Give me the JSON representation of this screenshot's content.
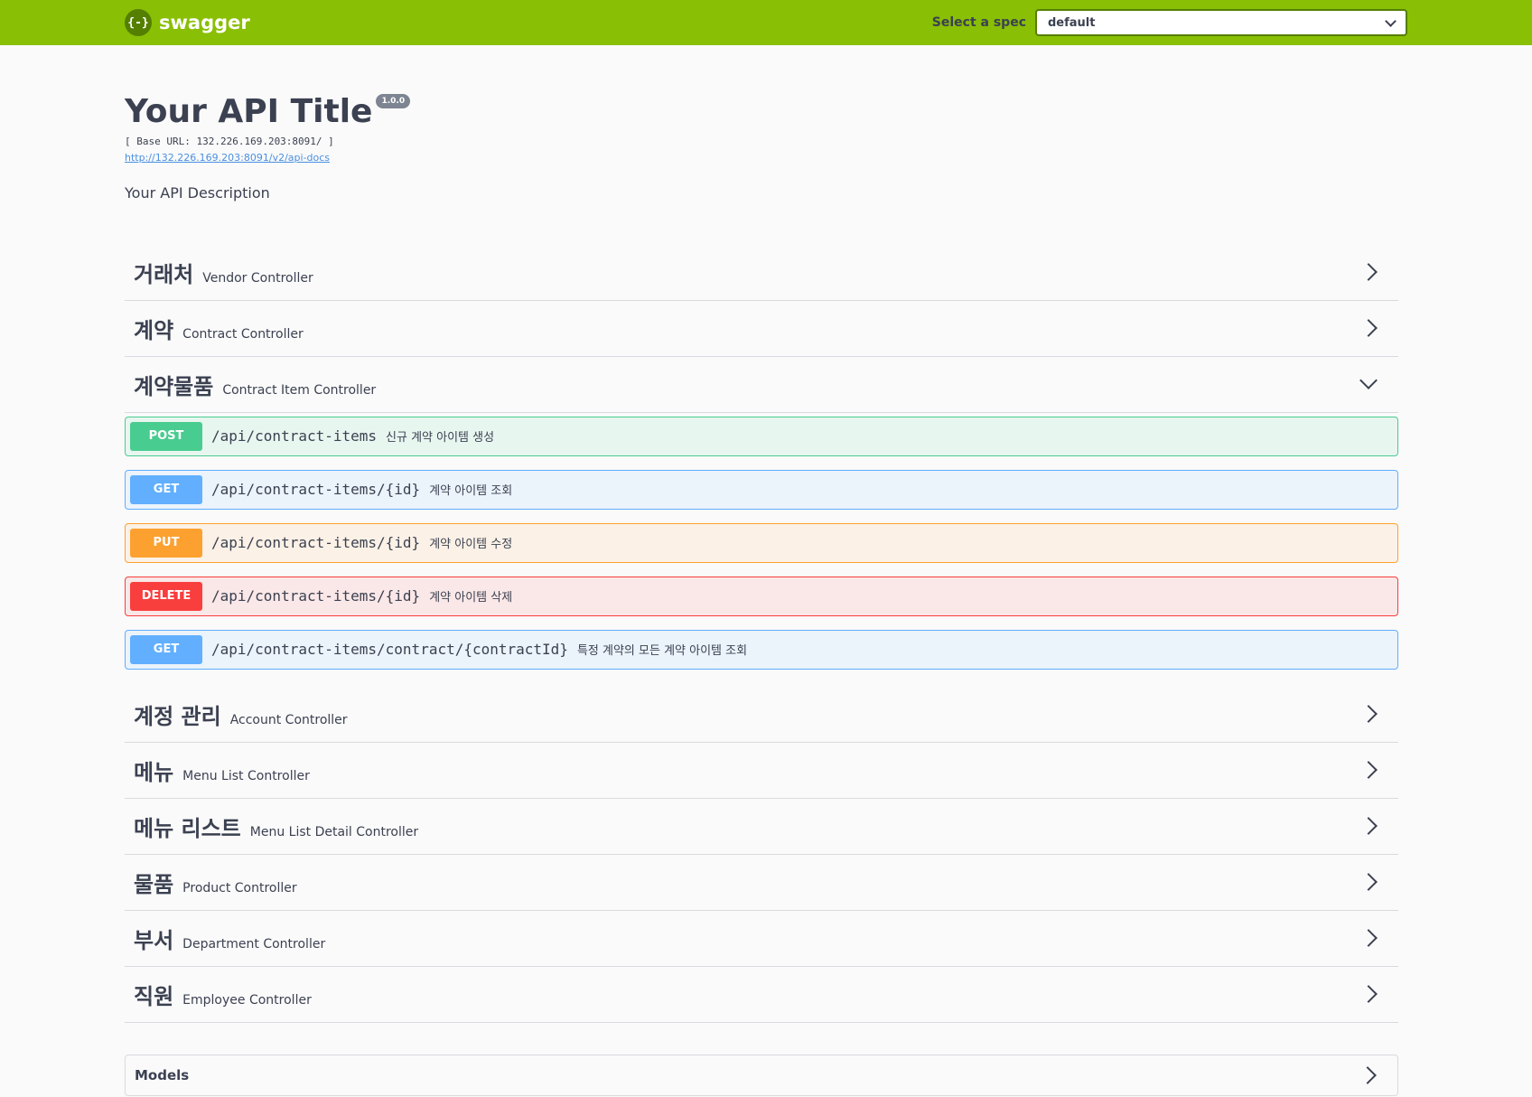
{
  "topbar": {
    "logo_glyph": "{-}",
    "brand": "swagger",
    "spec_label": "Select a spec",
    "spec_value": "default"
  },
  "info": {
    "title": "Your API Title",
    "version": "1.0.0",
    "base_url": "[ Base URL: 132.226.169.203:8091/ ]",
    "docs_link": "http://132.226.169.203:8091/v2/api-docs",
    "description": "Your API Description"
  },
  "tags_before": [
    {
      "name": "거래처",
      "desc": "Vendor Controller"
    },
    {
      "name": "계약",
      "desc": "Contract Controller"
    }
  ],
  "open_tag": {
    "name": "계약물품",
    "desc": "Contract Item Controller"
  },
  "operations": [
    {
      "method": "POST",
      "path": "/api/contract-items",
      "summary": "신규 계약 아이템 생성"
    },
    {
      "method": "GET",
      "path": "/api/contract-items/{id}",
      "summary": "계약 아이템 조회"
    },
    {
      "method": "PUT",
      "path": "/api/contract-items/{id}",
      "summary": "계약 아이템 수정"
    },
    {
      "method": "DELETE",
      "path": "/api/contract-items/{id}",
      "summary": "계약 아이템 삭제"
    },
    {
      "method": "GET",
      "path": "/api/contract-items/contract/{contractId}",
      "summary": "특정 계약의 모든 계약 아이템 조회"
    }
  ],
  "tags_after": [
    {
      "name": "계정 관리",
      "desc": "Account Controller"
    },
    {
      "name": "메뉴",
      "desc": "Menu List Controller"
    },
    {
      "name": "메뉴 리스트",
      "desc": "Menu List Detail Controller"
    },
    {
      "name": "물품",
      "desc": "Product Controller"
    },
    {
      "name": "부서",
      "desc": "Department Controller"
    },
    {
      "name": "직원",
      "desc": "Employee Controller"
    }
  ],
  "models": {
    "title": "Models"
  },
  "colors": {
    "topbar": "#89bf04",
    "post": "#49cc90",
    "get": "#61affe",
    "put": "#fca130",
    "delete": "#f93e3e"
  }
}
